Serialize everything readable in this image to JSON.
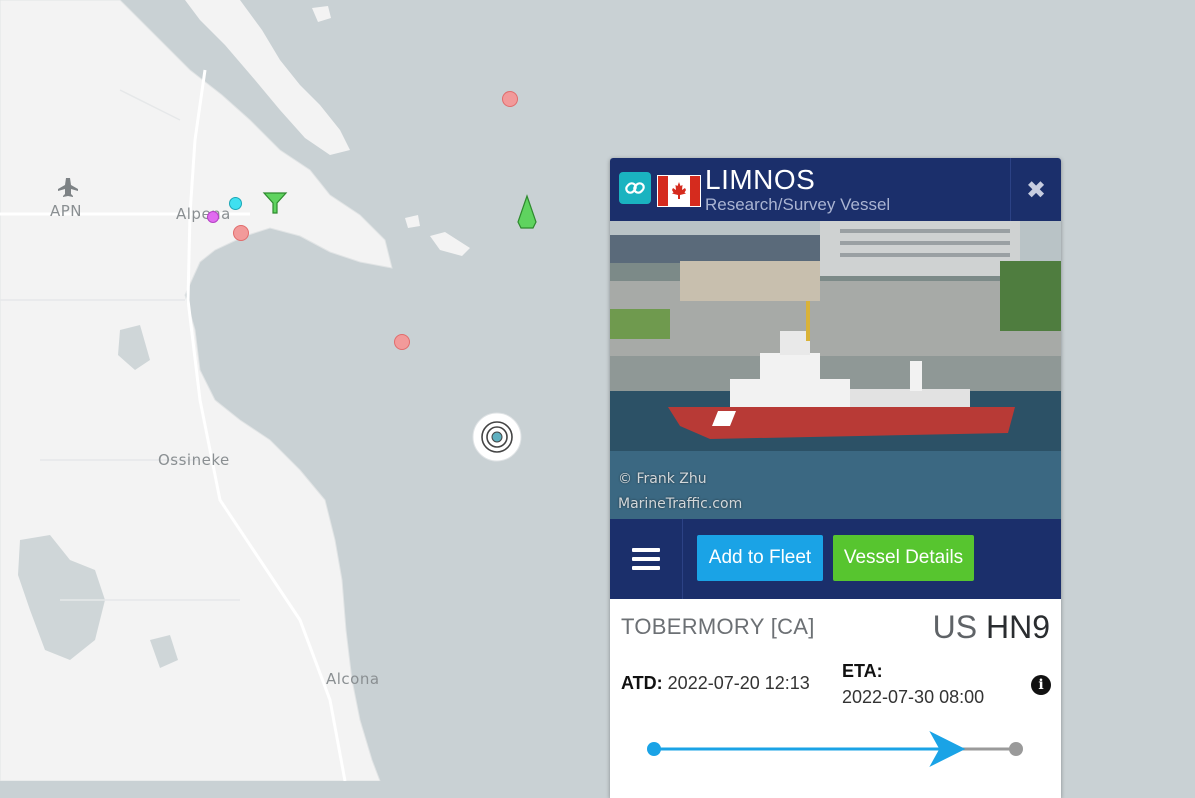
{
  "map": {
    "labels": {
      "airport_code": "APN",
      "city_alpena": "Alpena",
      "city_ossineke": "Ossineke",
      "city_alcona": "Alcona"
    },
    "colors": {
      "water": "#c9d1d4",
      "land": "#f3f3f3",
      "vessel_red": "#f29a9a",
      "vessel_green": "#5fd35f",
      "vessel_cyan": "#3fe0f0",
      "vessel_magenta": "#e06cf0"
    }
  },
  "panel": {
    "vessel_name": "LIMNOS",
    "vessel_type": "Research/Survey Vessel",
    "flag": "canada-flag",
    "photo_credit_1": "© Frank Zhu",
    "photo_credit_2": "MarineTraffic.com",
    "buttons": {
      "add_to_fleet": "Add to Fleet",
      "vessel_details": "Vessel Details"
    },
    "voyage": {
      "departure_port": "TOBERMORY [CA]",
      "destination_country": "US",
      "destination_code": "HN9",
      "atd_label": "ATD:",
      "atd_value": "2022-07-20 12:13",
      "eta_label": "ETA:",
      "eta_value": "2022-07-30 08:00",
      "progress": 0.86
    },
    "colors": {
      "header": "#1b2f6b",
      "fleet_button": "#1aa3e6",
      "details_button": "#57c52f",
      "link_button": "#1ab3c0",
      "progress": "#1aa3e6"
    }
  }
}
